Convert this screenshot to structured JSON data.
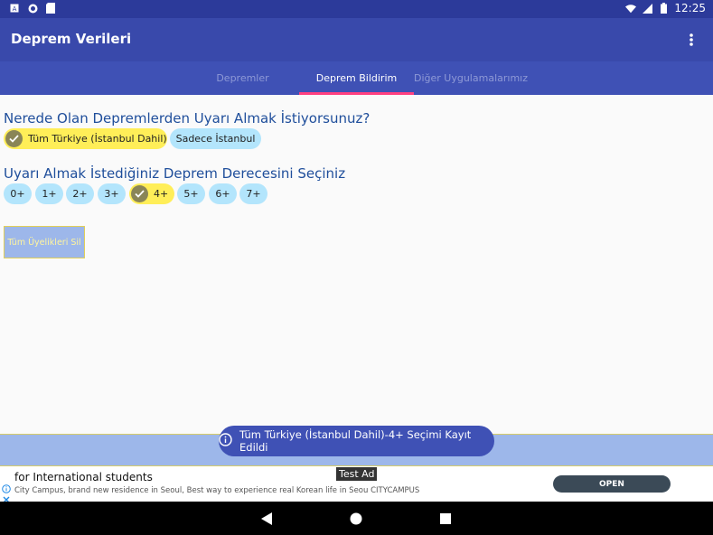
{
  "status": {
    "time": "12:25",
    "left_icons": [
      "a-box-icon",
      "circle-icon",
      "sd-card-icon"
    ],
    "right_icons": [
      "wifi-icon",
      "signal-icon",
      "battery-icon"
    ]
  },
  "app": {
    "title": "Deprem Verileri",
    "menu_icon": "overflow-menu-icon"
  },
  "tabs": [
    {
      "label": "Depremler",
      "active": false
    },
    {
      "label": "Deprem Bildirim",
      "active": true
    },
    {
      "label": "Diğer Uygulamalarımız",
      "active": false
    }
  ],
  "region": {
    "question": "Nerede Olan Depremlerden Uyarı Almak İstiyorsunuz?",
    "options": [
      {
        "label": "Tüm Türkiye (İstanbul Dahil)",
        "selected": true
      },
      {
        "label": "Sadece İstanbul",
        "selected": false
      }
    ]
  },
  "magnitude": {
    "question": "Uyarı Almak İstediğiniz Deprem Derecesini Seçiniz",
    "options": [
      {
        "label": "0+",
        "selected": false
      },
      {
        "label": "1+",
        "selected": false
      },
      {
        "label": "2+",
        "selected": false
      },
      {
        "label": "3+",
        "selected": false
      },
      {
        "label": "4+",
        "selected": true
      },
      {
        "label": "5+",
        "selected": false
      },
      {
        "label": "6+",
        "selected": false
      },
      {
        "label": "7+",
        "selected": false
      }
    ]
  },
  "delete_button": {
    "label": "Tüm Üyelikleri Sil"
  },
  "toast": {
    "message": "Tüm Türkiye (İstanbul Dahil)-4+ Seçimi Kayıt Edildi",
    "icon": "info-icon"
  },
  "ad": {
    "title": "for International students",
    "description": "City Campus, brand new residence in Seoul, Best way to experience real Korean life in Seou CITYCAMPUS",
    "badge": "Test Ad",
    "cta": "OPEN"
  },
  "nav": {
    "icons": [
      "back-icon",
      "home-icon",
      "recents-icon"
    ]
  },
  "colors": {
    "statusbar": "#2c3a9a",
    "appbar": "#3949ab",
    "tabbar": "#3f51b5",
    "indicator": "#ff4081",
    "chip": "#b3e5fc",
    "chip_selected": "#ffee58",
    "question_text": "#1f4e9b"
  }
}
